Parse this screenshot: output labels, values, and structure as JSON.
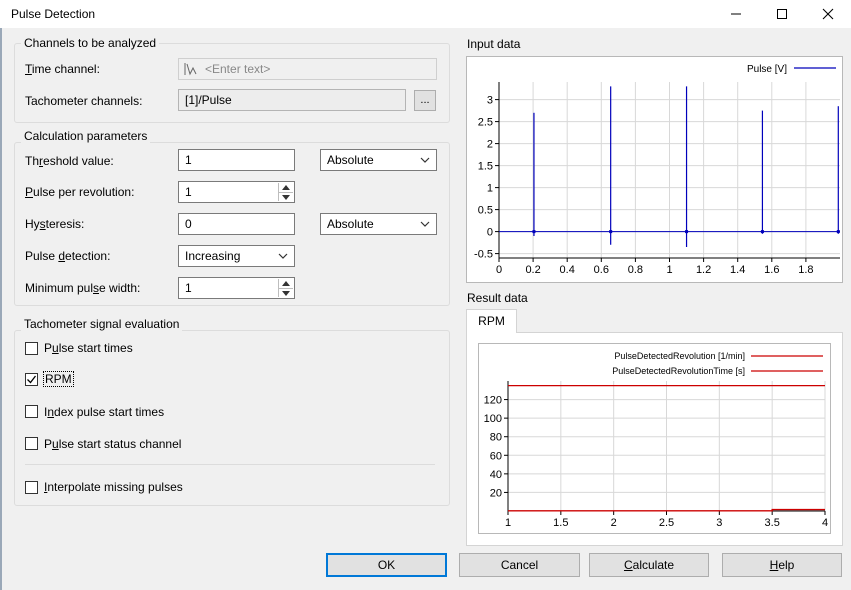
{
  "window": {
    "title": "Pulse Detection"
  },
  "channels": {
    "group_title": "Channels to be analyzed",
    "time_channel_label_u": "T",
    "time_channel_label_rest": "ime channel:",
    "time_channel_placeholder": "<Enter text>",
    "tacho_label": "Tachometer channels:",
    "tacho_value": "[1]/Pulse",
    "browse_label": "..."
  },
  "calc": {
    "group_title": "Calculation parameters",
    "threshold_label_a": "Th",
    "threshold_label_u": "r",
    "threshold_label_b": "eshold value:",
    "threshold_value": "1",
    "threshold_mode": "Absolute",
    "ppr_label_u": "P",
    "ppr_label_b": "ulse per revolution:",
    "ppr_value": "1",
    "hyst_label_a": "Hy",
    "hyst_label_u": "s",
    "hyst_label_b": "teresis:",
    "hyst_value": "0",
    "hyst_mode": "Absolute",
    "detect_label_a": "Pulse ",
    "detect_label_u": "d",
    "detect_label_b": "etection:",
    "detect_value": "Increasing",
    "minwidth_label_a": "Minimum pul",
    "minwidth_label_u": "s",
    "minwidth_label_b": "e width:",
    "minwidth_value": "1"
  },
  "evaluation": {
    "group_title": "Tachometer signal evaluation",
    "pulse_start_a": "P",
    "pulse_start_u": "u",
    "pulse_start_b": "lse start times",
    "rpm_label": "RPM",
    "index_a": "I",
    "index_u": "n",
    "index_b": "dex pulse start times",
    "status_a": "P",
    "status_u": "u",
    "status_b": "lse start status channel",
    "interp_u": "I",
    "interp_b": "nterpolate missing pulses",
    "checked": {
      "pulse_start": false,
      "rpm": true,
      "index": false,
      "status": false,
      "interp": false
    }
  },
  "input_section": {
    "label": "Input data"
  },
  "result_section": {
    "label": "Result data",
    "tab_label": "RPM"
  },
  "buttons": {
    "ok": "OK",
    "cancel": "Cancel",
    "calculate_u": "C",
    "calculate_b": "alculate",
    "help_u": "H",
    "help_b": "elp"
  },
  "icons": {
    "minimize": "minimize-icon",
    "maximize": "maximize-icon",
    "close": "close-icon",
    "channel": "channel-waveform-icon",
    "dropdown": "chevron-down-icon"
  },
  "colors": {
    "input_series": "#0000bb",
    "result_series_1": "#cc0000",
    "result_series_2": "#cc0000",
    "default_button_border": "#0078d7"
  },
  "chart_data": [
    {
      "type": "line",
      "title": "",
      "legend": [
        "Pulse [V]"
      ],
      "legend_position": "top-right",
      "xlim": [
        0,
        2
      ],
      "ylim": [
        -0.6,
        3.4
      ],
      "xticks": [
        0,
        0.2,
        0.4,
        0.6,
        0.8,
        1,
        1.2,
        1.4,
        1.6,
        1.8
      ],
      "xtick_labels": [
        "0",
        "0.2",
        "0.4",
        "0.6",
        "0.8",
        "1",
        "1.2",
        "1.4",
        "1.6",
        "1.8"
      ],
      "yticks": [
        -0.5,
        0,
        0.5,
        1,
        1.5,
        2,
        2.5,
        3
      ],
      "ytick_labels": [
        "-0.5",
        "0",
        "0.5",
        "1",
        "1.5",
        "2",
        "2.5",
        "3"
      ],
      "grid": true,
      "series": [
        {
          "name": "Pulse [V]",
          "color": "#0000bb",
          "baseline": 0,
          "spikes": [
            {
              "x": 0.205,
              "high": 2.7,
              "low": -0.1
            },
            {
              "x": 0.655,
              "high": 3.3,
              "low": -0.3
            },
            {
              "x": 1.1,
              "high": 3.3,
              "low": -0.35
            },
            {
              "x": 1.545,
              "high": 2.75,
              "low": -0.05
            },
            {
              "x": 1.99,
              "high": 2.85,
              "low": -0.05
            }
          ]
        }
      ]
    },
    {
      "type": "line",
      "title": "",
      "legend": [
        "PulseDetectedRevolution [1/min]",
        "PulseDetectedRevolutionTime [s]"
      ],
      "legend_position": "top-right",
      "xlim": [
        1,
        4
      ],
      "ylim": [
        0,
        140
      ],
      "xticks": [
        1,
        1.5,
        2,
        2.5,
        3,
        3.5,
        4
      ],
      "xtick_labels": [
        "1",
        "1.5",
        "2",
        "2.5",
        "3",
        "3.5",
        "4"
      ],
      "yticks": [
        20,
        40,
        60,
        80,
        100,
        120
      ],
      "ytick_labels": [
        "20",
        "40",
        "60",
        "80",
        "100",
        "120"
      ],
      "grid": true,
      "series": [
        {
          "name": "PulseDetectedRevolution [1/min]",
          "color": "#cc0000",
          "x": [
            1,
            4
          ],
          "y": [
            135,
            135
          ]
        },
        {
          "name": "PulseDetectedRevolutionTime [s]",
          "color": "#cc0000",
          "x": [
            1,
            3.5,
            3.5,
            4
          ],
          "y": [
            0.2,
            0.2,
            1.5,
            1.5
          ]
        }
      ]
    }
  ]
}
